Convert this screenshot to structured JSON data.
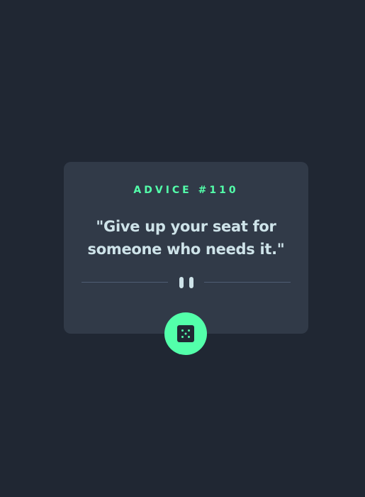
{
  "advice": {
    "id_label": "ADVICE #110",
    "text": "\"Give up your seat for someone who needs it.\""
  },
  "icons": {
    "divider": "pause-icon",
    "button": "dice-icon"
  },
  "colors": {
    "background": "#202733",
    "card": "#313a48",
    "accent": "#53ffaa",
    "text": "#cee3e9",
    "divider_line": "#4f5d74"
  }
}
